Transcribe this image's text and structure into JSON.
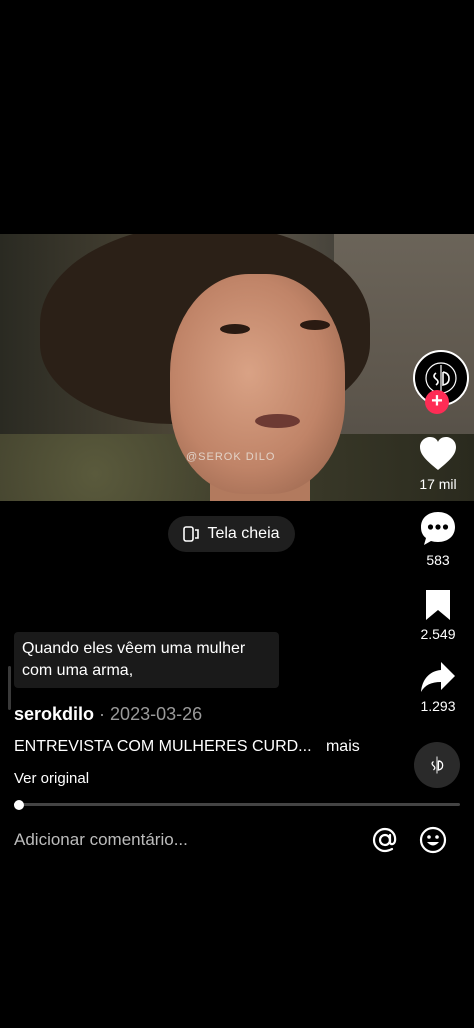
{
  "video": {
    "watermark": "@SEROK DILO",
    "fullscreen_label": "Tela cheia"
  },
  "side": {
    "likes": "17 mil",
    "comments": "583",
    "saves": "2.549",
    "shares": "1.293",
    "accent": "#fe2c55"
  },
  "caption": {
    "text": "Quando eles vêem uma mulher com uma arma,"
  },
  "post": {
    "author": "serokdilo",
    "date": "· 2023-03-26",
    "description": "ENTREVISTA COM MULHERES CURD...",
    "more_label": "mais",
    "original_label": "Ver original",
    "progress": 0.01
  },
  "comment": {
    "placeholder": "Adicionar comentário..."
  }
}
